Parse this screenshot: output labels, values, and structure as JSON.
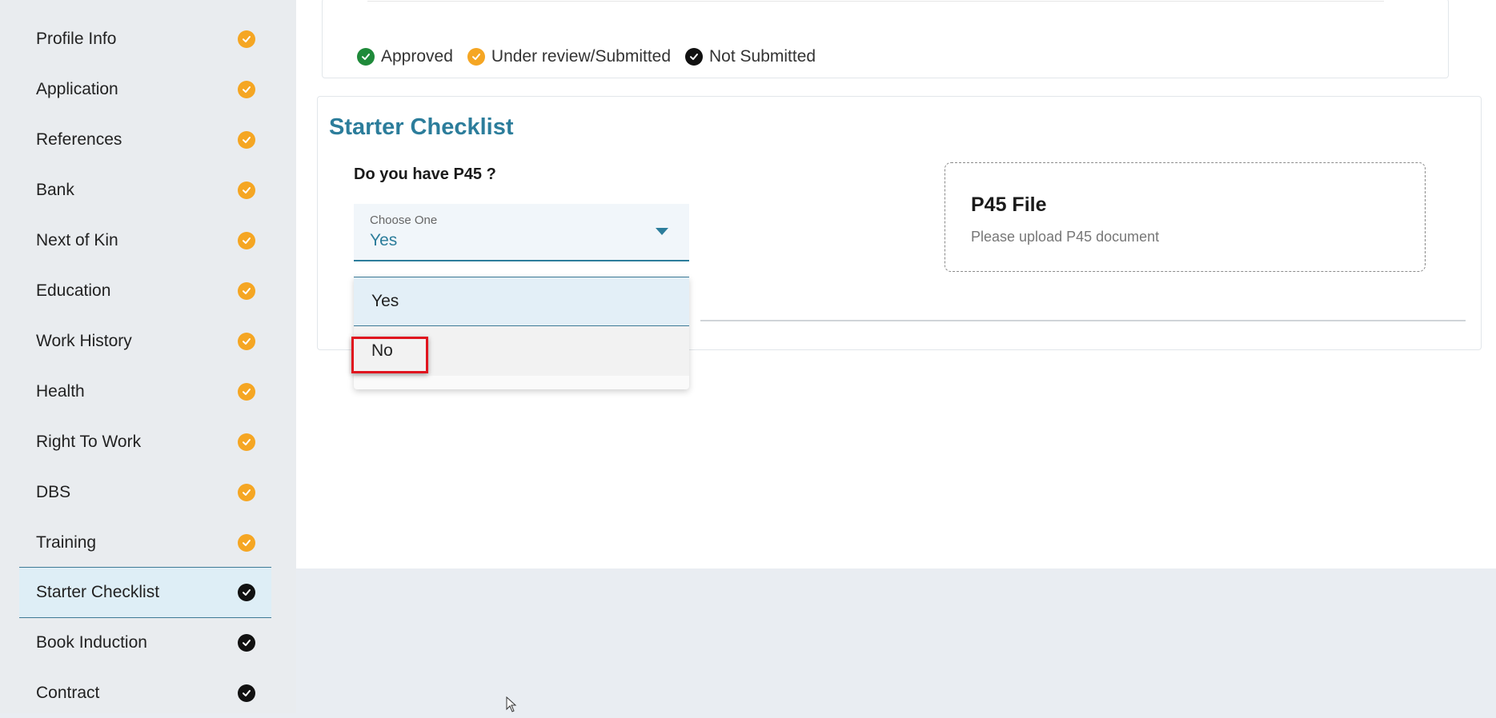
{
  "sidebar": {
    "items": [
      {
        "label": "Profile Info",
        "status": "under-review"
      },
      {
        "label": "Application",
        "status": "under-review"
      },
      {
        "label": "References",
        "status": "under-review"
      },
      {
        "label": "Bank",
        "status": "under-review"
      },
      {
        "label": "Next of Kin",
        "status": "under-review"
      },
      {
        "label": "Education",
        "status": "under-review"
      },
      {
        "label": "Work History",
        "status": "under-review"
      },
      {
        "label": "Health",
        "status": "under-review"
      },
      {
        "label": "Right To Work",
        "status": "under-review"
      },
      {
        "label": "DBS",
        "status": "under-review"
      },
      {
        "label": "Training",
        "status": "under-review"
      },
      {
        "label": "Starter Checklist",
        "status": "not-submitted",
        "active": true
      },
      {
        "label": "Book Induction",
        "status": "not-submitted"
      },
      {
        "label": "Contract",
        "status": "not-submitted"
      }
    ]
  },
  "legend": {
    "approved": "Approved",
    "under_review": "Under review/Submitted",
    "not_submitted": "Not Submitted"
  },
  "colors": {
    "approved": "#1f8a3a",
    "under_review": "#f5a623",
    "not_submitted": "#111111",
    "accent": "#2c7d9b"
  },
  "checklist": {
    "title": "Starter Checklist",
    "question": "Do you have P45 ?",
    "select": {
      "label": "Choose One",
      "value": "Yes",
      "options": [
        "Yes",
        "No"
      ]
    },
    "upload": {
      "title": "P45 File",
      "subtitle": "Please upload P45 document"
    }
  }
}
